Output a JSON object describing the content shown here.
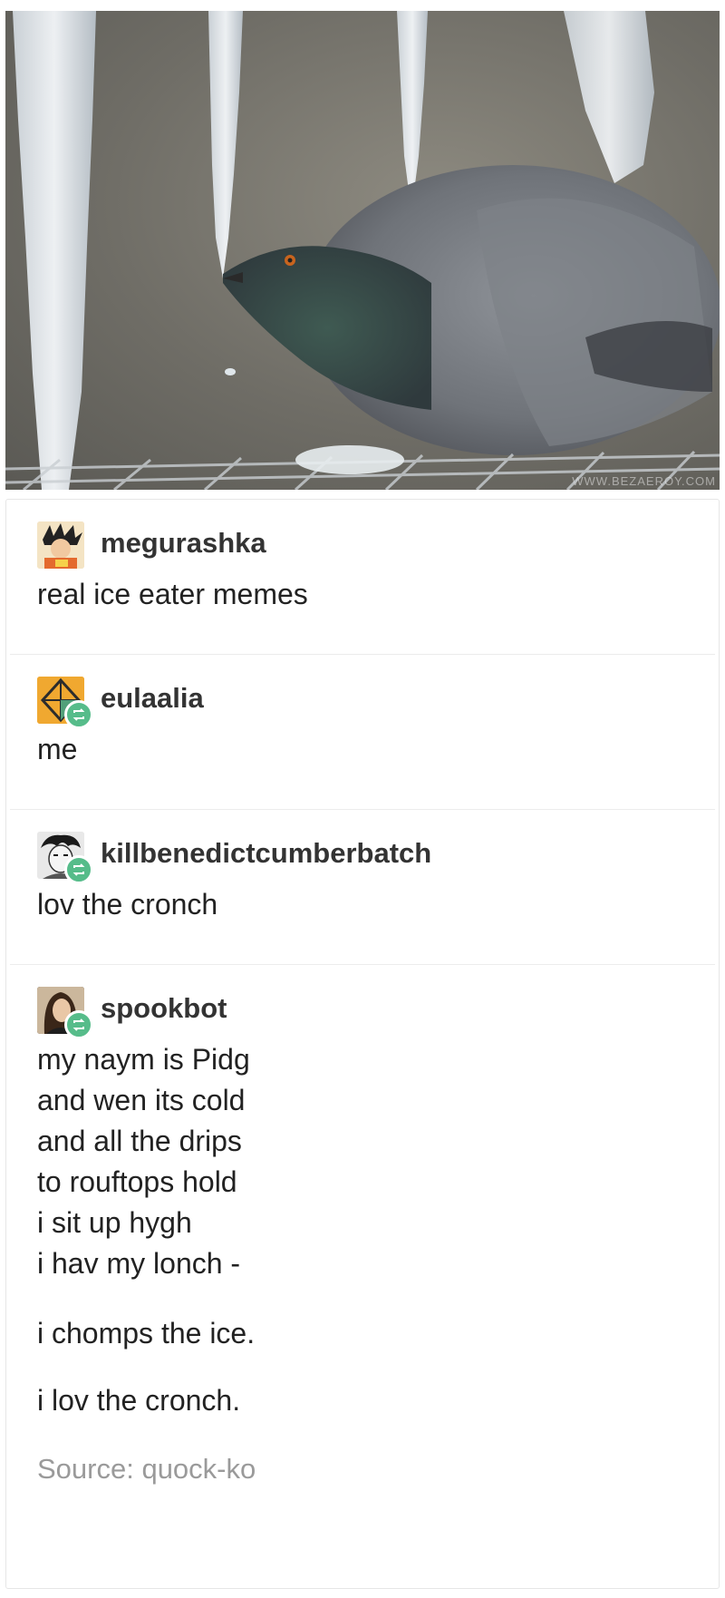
{
  "photo": {
    "watermark": "WWW.BEZAEROY.COM"
  },
  "posts": [
    {
      "username": "megurashka",
      "reblog": false,
      "lines": [
        "real ice eater memes"
      ]
    },
    {
      "username": "eulaalia",
      "reblog": true,
      "lines": [
        "me"
      ]
    },
    {
      "username": "killbenedictcumberbatch",
      "reblog": true,
      "lines": [
        "lov the cronch"
      ]
    },
    {
      "username": "spookbot",
      "reblog": true,
      "stanza1": [
        "my naym is Pidg",
        "and wen its cold",
        "and all the drips",
        "to rouftops hold",
        "i sit up hygh",
        "i hav my lonch -"
      ],
      "line2": "i chomps the ice.",
      "line3": "i lov the cronch."
    }
  ],
  "source": "Source: quock-ko",
  "colors": {
    "reblog_badge": "#56bc8a",
    "divider": "#ececec",
    "source_text": "#9a9a9a"
  },
  "icons": [
    "reblog-icon"
  ]
}
